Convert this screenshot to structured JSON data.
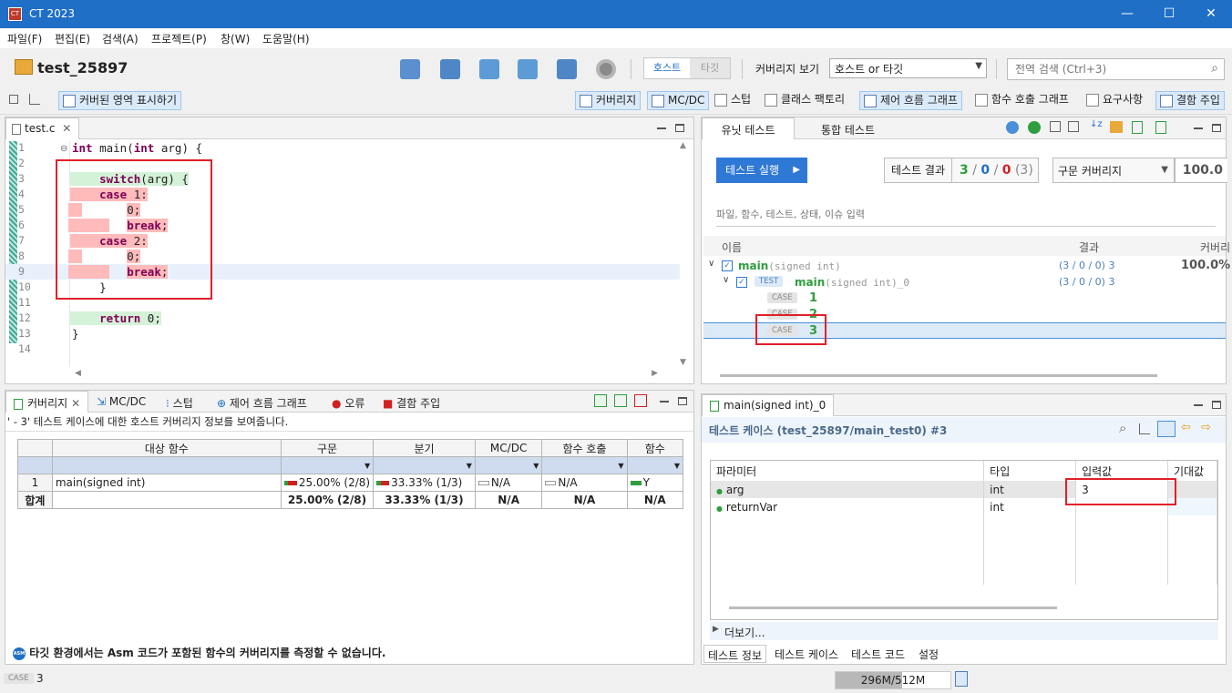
{
  "window": {
    "title": "CT 2023",
    "app_icon": "ct-app-icon",
    "min": "—",
    "max": "☐",
    "close": "✕"
  },
  "menu": [
    "파일(F)",
    "편집(E)",
    "검색(A)",
    "프로젝트(P)",
    "창(W)",
    "도움말(H)"
  ],
  "project": {
    "name": "test_25897"
  },
  "mode": {
    "host": "호스트",
    "target": "타깃"
  },
  "coverage_view": {
    "label": "커버리지 보기",
    "value": "호스트 or 타깃"
  },
  "search": {
    "placeholder": "전역 검색 (Ctrl+3)"
  },
  "toolbar2": {
    "show_covered": "커버된 영역 표시하기",
    "coverage": "커버리지",
    "mcdc": "MC/DC",
    "stub": "스텁",
    "class_factory": "클래스 팩토리",
    "cfg": "제어 흐름 그래프",
    "call_graph": "함수 호출 그래프",
    "requirements": "요구사항",
    "fault_injection": "결함 주입"
  },
  "editor": {
    "tab": "test.c",
    "lines": [
      {
        "n": "1",
        "text": "int main(int arg) {",
        "hl": "none"
      },
      {
        "n": "2",
        "text": "",
        "hl": "none"
      },
      {
        "n": "3",
        "text": "    switch(arg) {",
        "hl": "green"
      },
      {
        "n": "4",
        "text": "    case 1:",
        "hl": "red"
      },
      {
        "n": "5",
        "text": "        0;",
        "hl": "red"
      },
      {
        "n": "6",
        "text": "        break;",
        "hl": "red"
      },
      {
        "n": "7",
        "text": "    case 2:",
        "hl": "red"
      },
      {
        "n": "8",
        "text": "        0;",
        "hl": "red"
      },
      {
        "n": "9",
        "text": "        break;",
        "hl": "red"
      },
      {
        "n": "10",
        "text": "    }",
        "hl": "none"
      },
      {
        "n": "11",
        "text": "",
        "hl": "none"
      },
      {
        "n": "12",
        "text": "    return 0;",
        "hl": "green"
      },
      {
        "n": "13",
        "text": "}",
        "hl": "none"
      },
      {
        "n": "14",
        "text": "",
        "hl": "none"
      }
    ]
  },
  "unit": {
    "tab_unit": "유닛 테스트",
    "tab_integration": "통합 테스트",
    "run_button": "테스트 실행",
    "result_label": "테스트 결과",
    "result": {
      "pass": "3",
      "fail": "0",
      "err": "0",
      "total": "(3)",
      "sep": "/"
    },
    "coverage_type": "구문 커버리지",
    "coverage_value": "100.0",
    "filter_placeholder": "파일, 함수, 테스트, 상태, 이슈 입력",
    "col_name": "이름",
    "col_result": "결과",
    "col_coverage": "커버리",
    "tree": {
      "func": {
        "name": "main",
        "sig": "(signed int)",
        "result": "(3 / 0 / 0) 3",
        "coverage": "100.0%"
      },
      "test": {
        "badge": "TEST",
        "name": "main",
        "sig": "(signed int)_0",
        "result": "(3 / 0 / 0) 3"
      },
      "cases": [
        {
          "badge": "CASE",
          "num": "1"
        },
        {
          "badge": "CASE",
          "num": "2"
        },
        {
          "badge": "CASE",
          "num": "3"
        }
      ]
    }
  },
  "coverage_panel": {
    "tabs": {
      "coverage": "커버리지",
      "mcdc": "MC/DC",
      "stub": "스텁",
      "cfg": "제어 흐름 그래프",
      "error": "오류",
      "fault": "결함 주입"
    },
    "info": "' - 3' 테스트 케이스에 대한 호스트 커버리지 정보를 보여줍니다.",
    "headers": [
      "대상 함수",
      "구문",
      "분기",
      "MC/DC",
      "함수 호출",
      "함수"
    ],
    "rows": [
      {
        "idx": "1",
        "func": "main(signed int)",
        "stmt": "25.00% (2/8)",
        "branch": "33.33% (1/3)",
        "mcdc": "N/A",
        "call": "N/A",
        "fn": "Y"
      }
    ],
    "total": {
      "label": "합계",
      "stmt": "25.00% (2/8)",
      "branch": "33.33% (1/3)",
      "mcdc": "N/A",
      "call": "N/A",
      "fn": "N/A"
    },
    "note": "타깃 환경에서는 Asm 코드가 포함된 함수의 커버리지를 측정할 수 없습니다.",
    "note_badge": "ASM"
  },
  "detail": {
    "tab": "main(signed int)_0",
    "title": "테스트 케이스 (test_25897/main_test0) #3",
    "headers": [
      "파라미터",
      "타입",
      "입력값",
      "기대값"
    ],
    "params": [
      {
        "name": "arg",
        "type": "int",
        "input": "3",
        "expected": ""
      },
      {
        "name": "returnVar",
        "type": "int",
        "input": "",
        "expected": ""
      }
    ],
    "more": "더보기...",
    "bottom_tabs": [
      "테스트 정보",
      "테스트 케이스",
      "테스트 코드",
      "설정"
    ]
  },
  "status": {
    "badge": "CASE",
    "value": "3",
    "memory": "296M/512M"
  },
  "colors": {
    "titlebar": "#1f6fc6",
    "accent": "#1f6fc6",
    "pass": "#2e9e3e",
    "fail": "#d02020",
    "highlight_red": "#ffbaba",
    "highlight_green": "#d4f2d8",
    "annotation": "#e0202a"
  }
}
